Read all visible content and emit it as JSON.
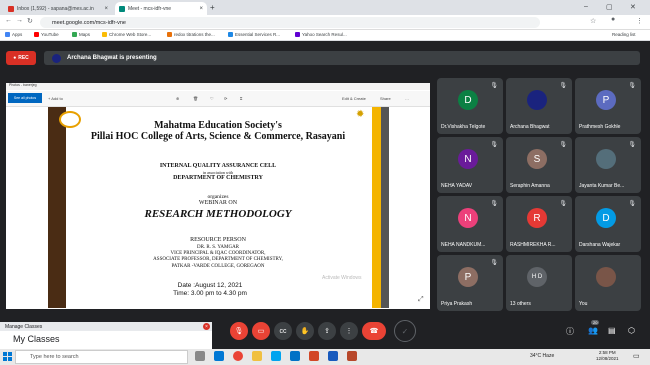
{
  "browser": {
    "tabs": [
      {
        "label": "Inbox (1,592) - sapana@mes.ac.in",
        "color": "#d93025"
      },
      {
        "label": "Meet - mcs-idfr-vne",
        "color": "#00897b"
      }
    ],
    "url": "meet.google.com/mcs-idfr-vne",
    "bookmarks": [
      {
        "label": "Apps",
        "color": "#4285f4"
      },
      {
        "label": "YouTube",
        "color": "#ff0000"
      },
      {
        "label": "Maps",
        "color": "#34a853"
      },
      {
        "label": "Chrome Web Store...",
        "color": "#fbbc05"
      },
      {
        "label": "redox titrations the...",
        "color": "#e8710a"
      },
      {
        "label": "Essential Services R...",
        "color": "#1e88e5"
      },
      {
        "label": "Yahoo Search Resul...",
        "color": "#6001d2"
      }
    ],
    "reading_list": "Reading list"
  },
  "meet": {
    "rec_label": "REC",
    "presenting": "Archana Bhagwat is presenting",
    "photos": {
      "app_title": "Photos - banerjeg",
      "see_all": "See all photos",
      "add_to": "+ Add to",
      "edit_create": "Edit & Create",
      "share": "Share"
    },
    "poster": {
      "title1": "Mahatma Education Society's",
      "title2": "Pillai HOC College of Arts, Science & Commerce, Rasayani",
      "cell": "INTERNAL QUALITY ASSURANCE CELL",
      "assoc": "in association with",
      "dept": "DEPARTMENT OF CHEMISTRY",
      "organizes": "organizes",
      "webinar": "WEBINAR ON",
      "topic": "RESEARCH METHODOLOGY",
      "resource": "RESOURCE PERSON",
      "speaker": "DR. R. S. YAMGAR",
      "line1": "VICE PRINCIPAL & IQAC COORDINATOR,",
      "line2": "ASSOCIATE PROFESSOR, DEPARTMENT OF CHEMISTRY,",
      "line3": "PATKAR -VARDE COLLEGE, GOREGAON",
      "date": "Date :August 12, 2021",
      "time": "Time: 3.00 pm to 4.30 pm",
      "watermark": "Activate Windows"
    },
    "participants": [
      {
        "name": "Dr.Vishakha Telgote",
        "initial": "D",
        "color": "#0b8043"
      },
      {
        "name": "Archana Bhagwat",
        "initial": "",
        "color": "#1a237e"
      },
      {
        "name": "Prathmesh Gokhle",
        "initial": "P",
        "color": "#5c6bc0"
      },
      {
        "name": "NEHA YADAV",
        "initial": "N",
        "color": "#6a1b9a"
      },
      {
        "name": "Seraphin Amanna",
        "initial": "S",
        "color": "#8d6e63"
      },
      {
        "name": "Jayanta Kumar Be...",
        "initial": "",
        "color": "#546e7a"
      },
      {
        "name": "NEHA NANDKUM...",
        "initial": "N",
        "color": "#ec407a"
      },
      {
        "name": "RASHMIREKHA R...",
        "initial": "R",
        "color": "#e53935"
      },
      {
        "name": "Darshana Wajekar",
        "initial": "D",
        "color": "#039be5"
      },
      {
        "name": "Priya Prakash",
        "initial": "P",
        "color": "#8d6e63"
      },
      {
        "name": "13 others",
        "initial": "H D",
        "color": "#5f6368"
      },
      {
        "name": "You",
        "initial": "",
        "color": "#795548"
      }
    ],
    "participant_count": "20",
    "manage": {
      "header": "Manage Classes",
      "title": "My Classes"
    }
  },
  "taskbar": {
    "search_placeholder": "Type here to search",
    "weather": "34°C  Haze",
    "time": "2:58 PM",
    "date": "12/08/2021"
  }
}
